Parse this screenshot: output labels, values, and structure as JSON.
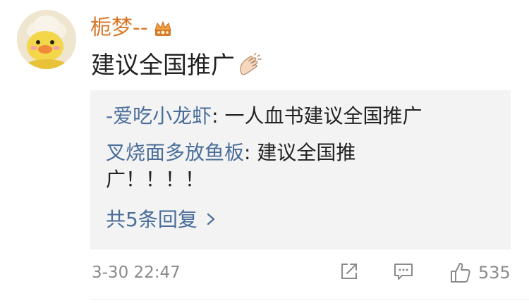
{
  "comment": {
    "username": "栀梦--",
    "badge_icon": "crown-icon",
    "text": "建议全国推广",
    "emoji_icon": "clapping-hands-icon"
  },
  "replies": [
    {
      "name": "-爱吃小龙虾",
      "sep": ": ",
      "text": "一人血书建议全国推广"
    },
    {
      "name": "叉烧面多放鱼板",
      "sep": ": ",
      "text": "建议全国推广！！！！"
    }
  ],
  "more_replies": {
    "label": "共5条回复",
    "icon": "chevron-right-icon"
  },
  "footer": {
    "timestamp": "3-30 22:47",
    "share_icon": "share-icon",
    "comment_icon": "comment-icon",
    "like_icon": "thumbs-up-icon",
    "like_count": "535"
  },
  "colors": {
    "username": "#d7792a",
    "link": "#4a6d9a",
    "reply_bg": "#f3f3f3",
    "muted": "#8a8a8a"
  }
}
